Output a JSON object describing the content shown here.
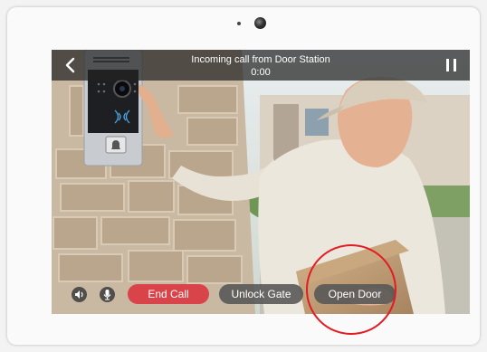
{
  "header": {
    "title": "Incoming call from Door Station",
    "timer": "0:00",
    "back_icon": "chevron-left-icon",
    "pause_icon": "pause-icon"
  },
  "controls": {
    "speaker_icon": "speaker-icon",
    "mic_icon": "microphone-icon",
    "end_call_label": "End Call",
    "unlock_gate_label": "Unlock Gate",
    "open_door_label": "Open Door"
  },
  "colors": {
    "end_call": "#d9434a",
    "highlight_circle": "#e31b23",
    "button_gray": "#555555"
  }
}
